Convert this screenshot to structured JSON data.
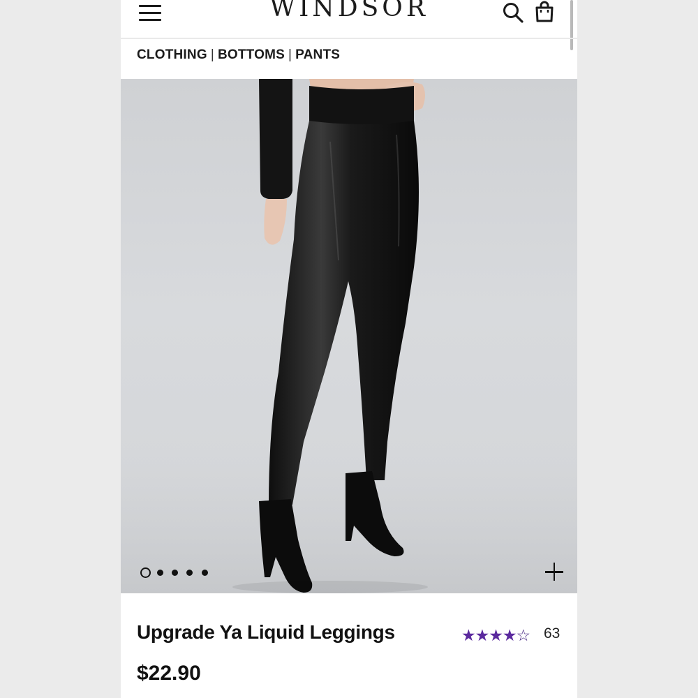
{
  "brand": {
    "logo_text": "WINDSOR"
  },
  "breadcrumb": {
    "items": [
      "CLOTHING",
      "BOTTOMS",
      "PANTS"
    ],
    "separator": "|"
  },
  "gallery": {
    "image_count": 5,
    "active_index": 0
  },
  "product": {
    "name": "Upgrade Ya Liquid Leggings",
    "price": "$22.90",
    "rating": 4,
    "rating_max": 5,
    "review_count": "63"
  },
  "colors": {
    "star": "#5b2a9e",
    "text": "#121212"
  },
  "icons": [
    "hamburger-menu-icon",
    "search-icon",
    "shopping-bag-icon",
    "plus-icon",
    "star-icon"
  ]
}
